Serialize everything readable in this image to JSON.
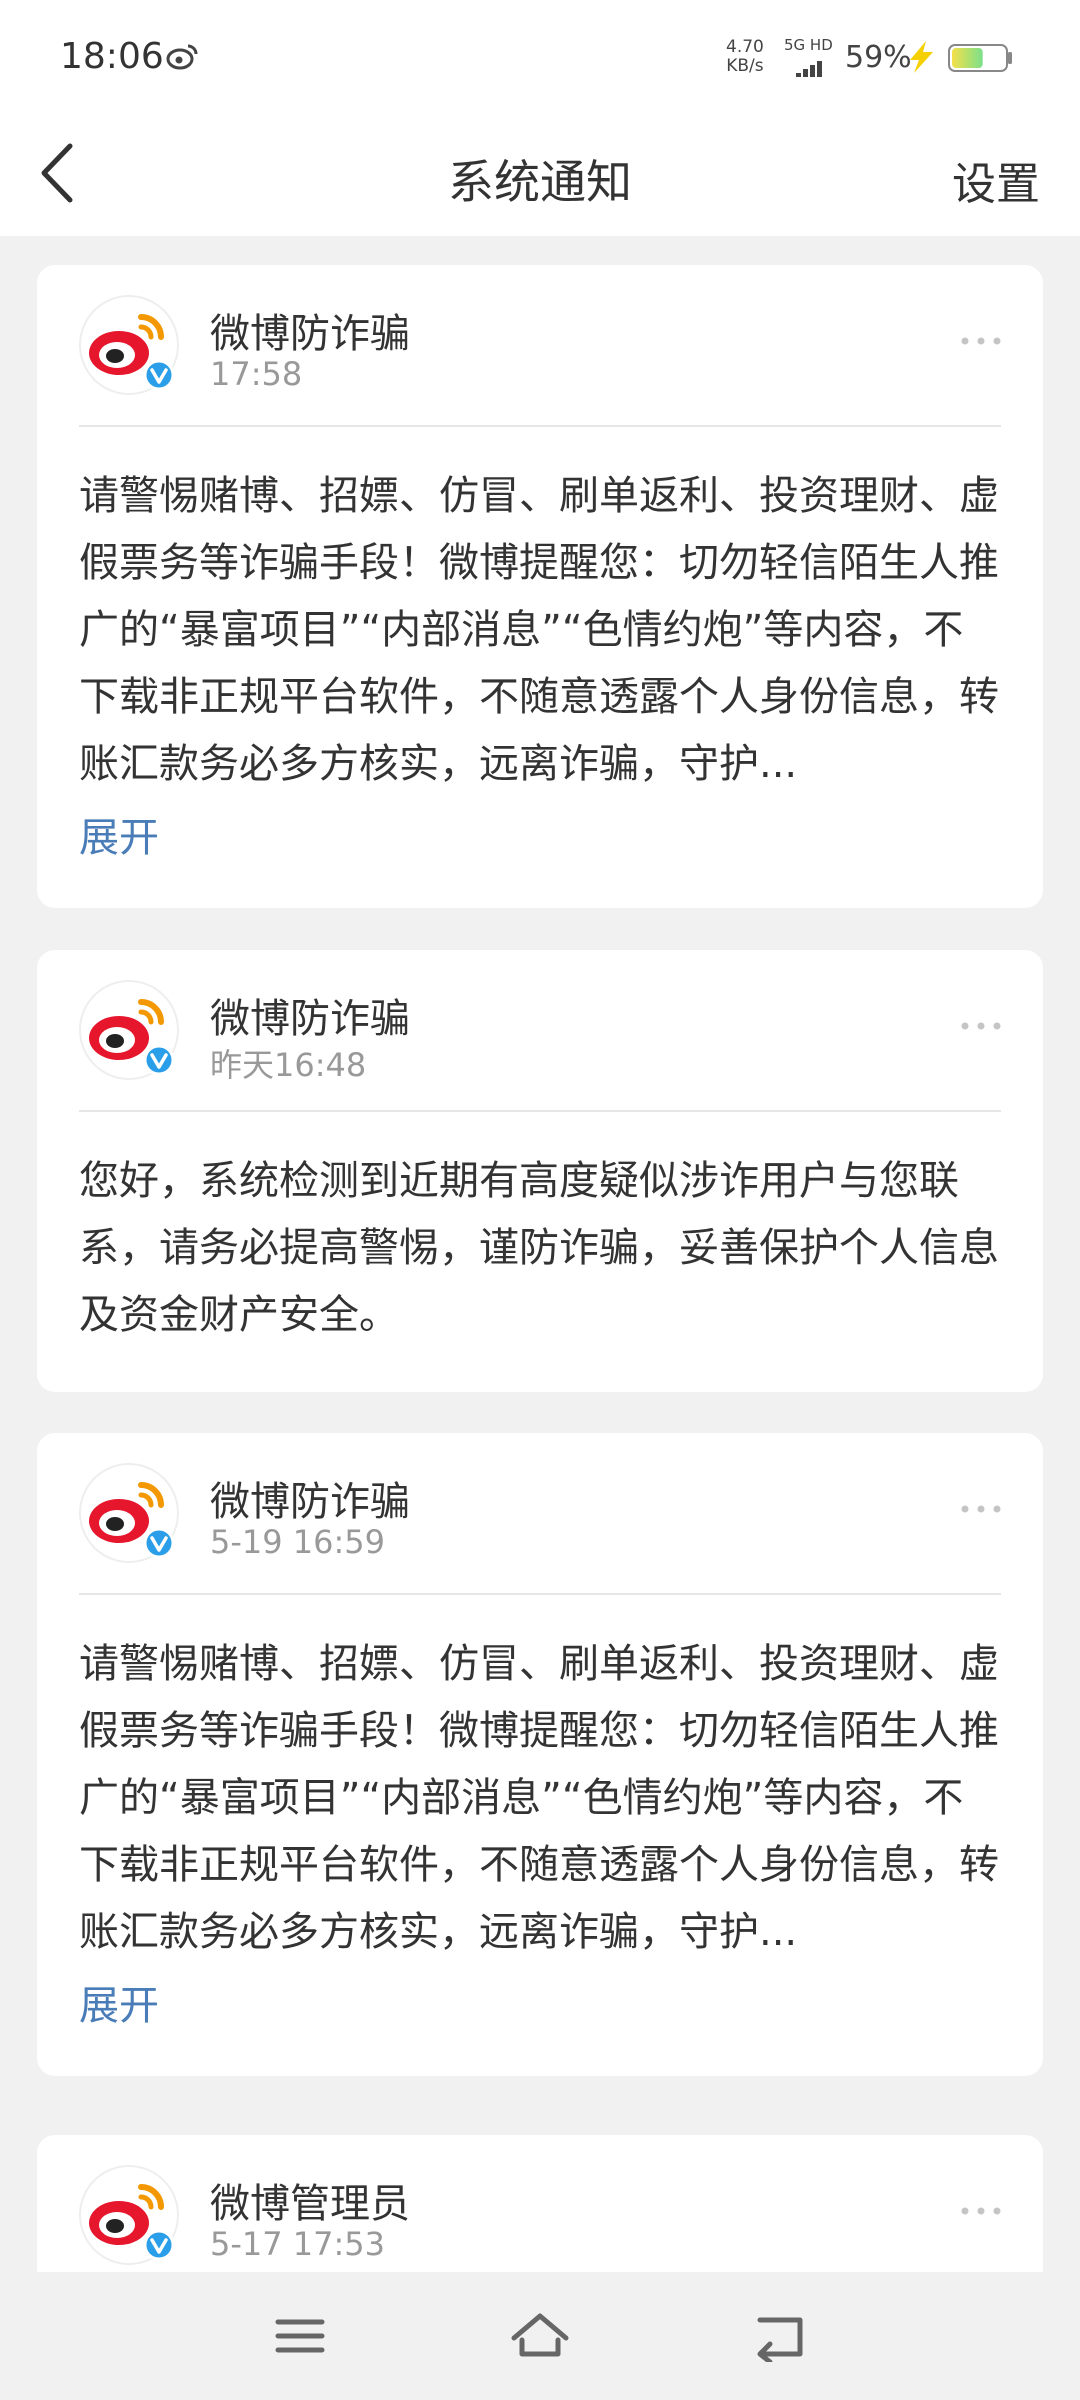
{
  "status_bar": {
    "time": "18:06",
    "net_speed_value": "4.70",
    "net_speed_unit": "KB/s",
    "network_label": "5G HD",
    "battery_percent": "59%",
    "battery_level": 0.59,
    "icons": [
      "weibo-icon",
      "signal-icon",
      "charging-bolt-icon",
      "battery-icon"
    ]
  },
  "header": {
    "title": "系统通知",
    "settings_label": "设置",
    "back_icon": "chevron-left-icon"
  },
  "notifications": [
    {
      "sender": "微博防诈骗",
      "time": "17:58",
      "content": "请警惕赌博、招嫖、仿冒、刷单返利、投资理财、虚假票务等诈骗手段！微博提醒您：切勿轻信陌生人推广的“暴富项目”“内部消息”“色情约炮”等内容，不下载非正规平台软件，不随意透露个人身份信息，转账汇款务必多方核实，远离诈骗，守护...",
      "expand_label": "展开"
    },
    {
      "sender": "微博防诈骗",
      "time": "昨天16:48",
      "content": "您好，系统检测到近期有高度疑似涉诈用户与您联系，请务必提高警惕，谨防诈骗，妥善保护个人信息及资金财产安全。"
    },
    {
      "sender": "微博防诈骗",
      "time": "5-19 16:59",
      "content": "请警惕赌博、招嫖、仿冒、刷单返利、投资理财、虚假票务等诈骗手段！微博提醒您：切勿轻信陌生人推广的“暴富项目”“内部消息”“色情约炮”等内容，不下载非正规平台软件，不随意透露个人身份信息，转账汇款务必多方核实，远离诈骗，守护...",
      "expand_label": "展开"
    },
    {
      "sender": "微博管理员",
      "time": "5-17 17:53"
    }
  ],
  "nav_bar": {
    "icons": [
      "menu-icon",
      "home-icon",
      "back-icon"
    ]
  },
  "colors": {
    "background": "#f1f1f1",
    "card": "#ffffff",
    "link": "#4a7db8",
    "verified_badge": "#2a9ee8",
    "weibo_red": "#e6162d",
    "weibo_orange": "#f39800"
  }
}
